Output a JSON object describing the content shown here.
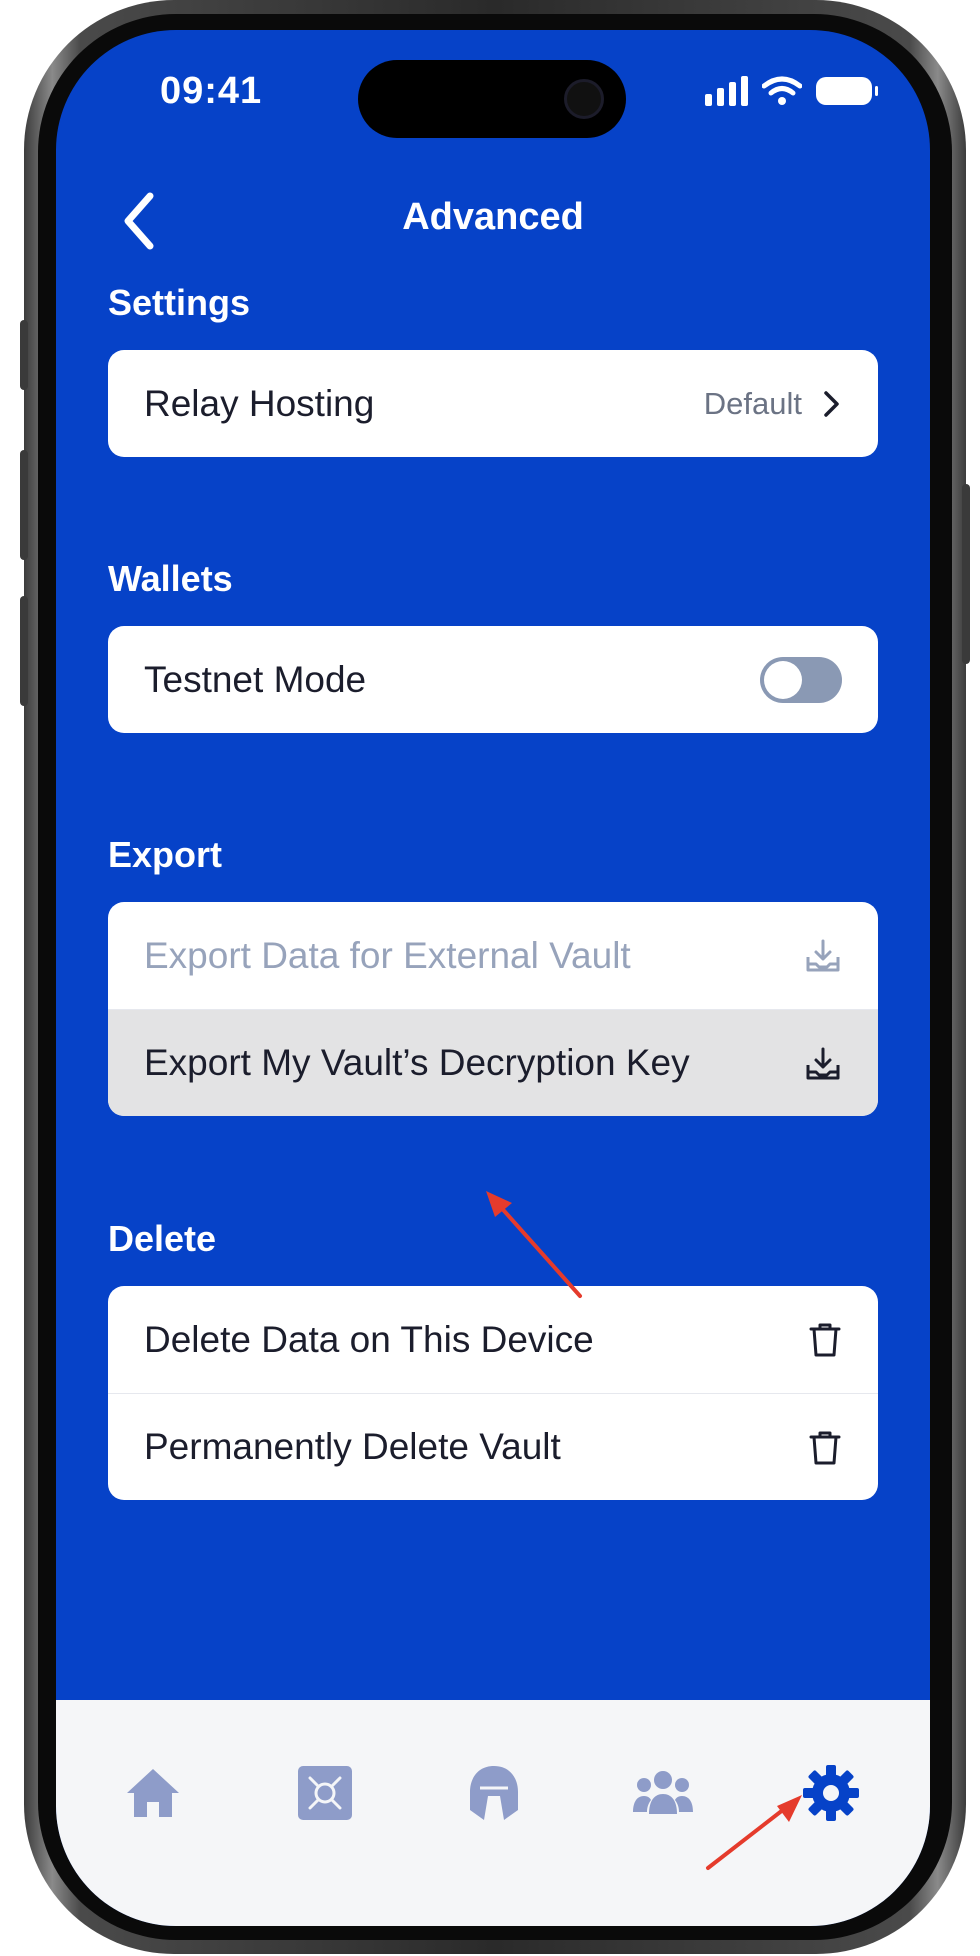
{
  "status_bar": {
    "time": "09:41"
  },
  "header": {
    "title": "Advanced"
  },
  "sections": {
    "settings": {
      "title": "Settings",
      "relay_hosting": {
        "label": "Relay Hosting",
        "value": "Default"
      }
    },
    "wallets": {
      "title": "Wallets",
      "testnet_mode": {
        "label": "Testnet Mode",
        "enabled": false
      }
    },
    "export": {
      "title": "Export",
      "items": [
        {
          "label": "Export Data for External Vault",
          "disabled": true
        },
        {
          "label": "Export My Vault’s Decryption Key",
          "highlighted": true
        }
      ]
    },
    "delete": {
      "title": "Delete",
      "items": [
        {
          "label": "Delete Data on This Device"
        },
        {
          "label": "Permanently Delete Vault"
        }
      ]
    }
  },
  "tab_bar": {
    "items": [
      {
        "icon": "home-icon",
        "active": false
      },
      {
        "icon": "vault-icon",
        "active": false
      },
      {
        "icon": "helmet-icon",
        "active": false
      },
      {
        "icon": "people-icon",
        "active": false
      },
      {
        "icon": "gear-icon",
        "active": true
      }
    ],
    "active_color": "#0642C8",
    "inactive_color": "#8E9CC9"
  },
  "colors": {
    "background": "#0642C8",
    "card": "#FFFFFF",
    "highlight_row": "#E3E3E4",
    "annotation_arrow": "#E53B2C"
  }
}
